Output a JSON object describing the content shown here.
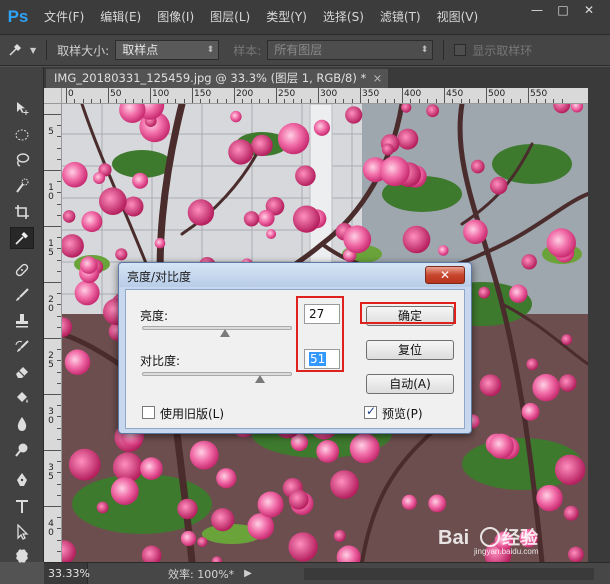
{
  "app": {
    "logo": "Ps",
    "menu": [
      "文件(F)",
      "编辑(E)",
      "图像(I)",
      "图层(L)",
      "类型(Y)",
      "选择(S)",
      "滤镜(T)",
      "视图(V)"
    ],
    "window_controls": {
      "minimize": "—",
      "maximize": "□",
      "close": "✕"
    }
  },
  "options": {
    "sample_size_label": "取样大小:",
    "sample_size_value": "取样点",
    "sample_label": "样本:",
    "sample_value": "所有图层",
    "show_ring_label": "显示取样环"
  },
  "document": {
    "tab_title": "IMG_20180331_125459.jpg @ 33.3% (图层 1, RGB/8) *",
    "tab_close": "×"
  },
  "ruler": {
    "top_labels": [
      "0",
      "50",
      "100",
      "150",
      "200",
      "250",
      "300",
      "350",
      "400",
      "450",
      "500",
      "550"
    ],
    "left_labels": [
      "5",
      "10",
      "15",
      "20",
      "25",
      "30",
      "35",
      "40"
    ]
  },
  "dialog": {
    "title": "亮度/对比度",
    "close": "✕",
    "brightness_label": "亮度:",
    "brightness_value": "27",
    "brightness_fraction": 0.55,
    "contrast_label": "对比度:",
    "contrast_value": "51",
    "contrast_fraction": 0.63,
    "ok_label": "确定",
    "reset_label": "复位",
    "auto_label": "自动(A)",
    "legacy_label": "使用旧版(L)",
    "legacy_checked": false,
    "preview_label": "预览(P)",
    "preview_checked": true
  },
  "status": {
    "zoom": "33.33%",
    "efficiency": "效率: 100%*",
    "arrow": "▶"
  },
  "colors": {
    "accent_red": "#e0201c",
    "ps_blue": "#2fa3f7"
  },
  "icons": [
    "move-icon",
    "marquee-icon",
    "lasso-icon",
    "quick-select-icon",
    "crop-icon",
    "eyedropper-icon",
    "healing-icon",
    "brush-icon",
    "stamp-icon",
    "history-brush-icon",
    "eraser-icon",
    "paint-bucket-icon",
    "blur-icon",
    "dodge-icon",
    "pen-icon",
    "type-icon",
    "path-select-icon",
    "custom-shape-icon"
  ]
}
